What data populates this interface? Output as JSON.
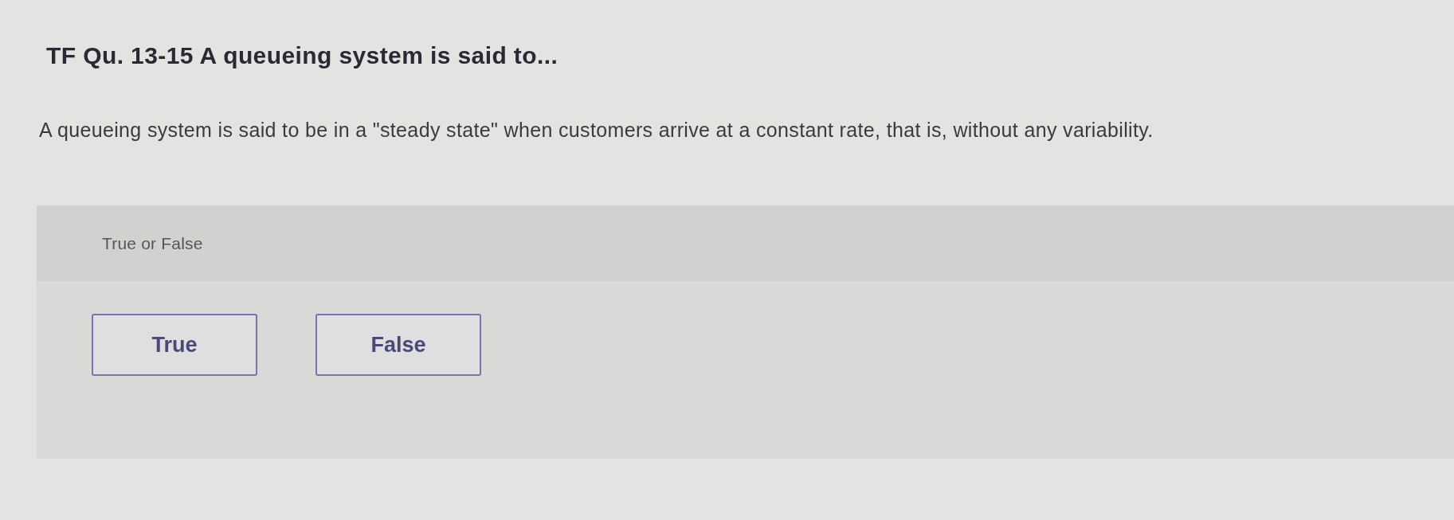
{
  "question": {
    "title": "TF Qu. 13-15 A queueing system is said to...",
    "text": "A queueing system is said to be in a \"steady state\" when customers arrive at a constant rate, that is, without any variability."
  },
  "answer": {
    "prompt": "True or False",
    "options": [
      {
        "label": "True",
        "selected": false
      },
      {
        "label": "False",
        "selected": false
      }
    ]
  }
}
